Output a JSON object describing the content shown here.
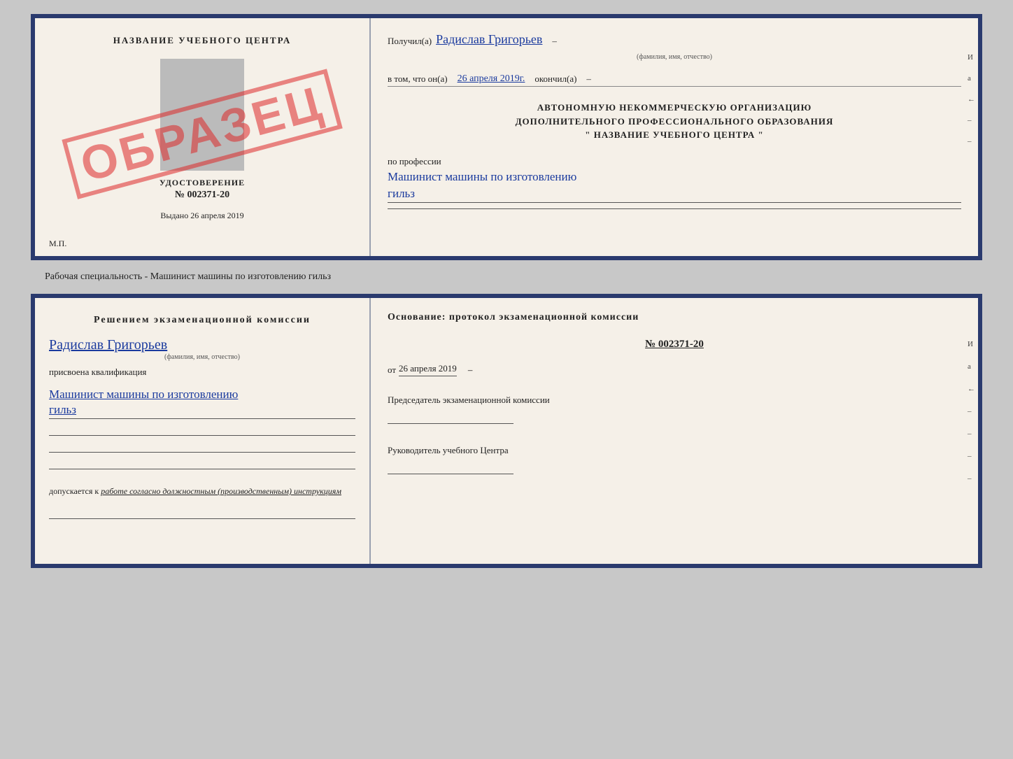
{
  "top_document": {
    "left": {
      "title": "НАЗВАНИЕ УЧЕБНОГО ЦЕНТРА",
      "cert_label": "УДОСТОВЕРЕНИЕ",
      "cert_number": "№ 002371-20",
      "issued_label": "Выдано",
      "issued_date": "26 апреля 2019",
      "mp_label": "М.П.",
      "stamp": "ОБРАЗЕЦ"
    },
    "right": {
      "received_label": "Получил(а)",
      "person_name": "Радислав Григорьев",
      "name_sublabel": "(фамилия, имя, отчество)",
      "in_that_label": "в том, что он(а)",
      "completion_date": "26 апреля 2019г.",
      "finished_label": "окончил(а)",
      "org_line1": "АВТОНОМНУЮ НЕКОММЕРЧЕСКУЮ ОРГАНИЗАЦИЮ",
      "org_line2": "ДОПОЛНИТЕЛЬНОГО ПРОФЕССИОНАЛЬНОГО ОБРАЗОВАНИЯ",
      "org_name": "\" НАЗВАНИЕ УЧЕБНОГО ЦЕНТРА \"",
      "profession_label": "по профессии",
      "profession": "Машинист машины по изготовлению",
      "profession2": "гильз",
      "side_marks": [
        "И",
        "а",
        "←",
        "–",
        "–",
        "–",
        "–"
      ]
    }
  },
  "between_label": "Рабочая специальность - Машинист машины по изготовлению гильз",
  "bottom_document": {
    "left": {
      "section_title": "Решением  экзаменационной  комиссии",
      "person_name": "Радислав Григорьев",
      "name_sublabel": "(фамилия, имя, отчество)",
      "assigned_label": "присвоена квалификация",
      "qualification": "Машинист  машины  по  изготовлению",
      "qualification2": "гильз",
      "allowed_label": "допускается к",
      "allowed_text": "работе согласно должностным (производственным) инструкциям"
    },
    "right": {
      "basis_label": "Основание:  протокол  экзаменационной  комиссии",
      "protocol_number": "№  002371-20",
      "date_prefix": "от",
      "protocol_date": "26 апреля 2019",
      "commission_chair_label": "Председатель экзаменационной комиссии",
      "center_head_label": "Руководитель учебного Центра",
      "side_marks": [
        "И",
        "а",
        "←",
        "–",
        "–",
        "–",
        "–"
      ]
    }
  }
}
